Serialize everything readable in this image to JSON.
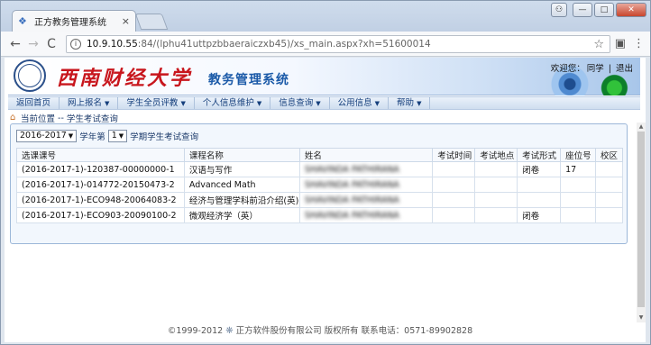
{
  "browser": {
    "tab_title": "正方教务管理系统",
    "tab_close": "×",
    "back": "←",
    "forward": "→",
    "reload": "C",
    "info_icon": "i",
    "url_host": "10.9.10.55",
    "url_path": ":84/(lphu41uttpzbbaeraiczxb45)/xs_main.aspx?xh=51600014",
    "star": "☆",
    "minimize": "—",
    "maximize": "□",
    "close": "✕",
    "user": "⚇",
    "menu": "⋮",
    "ext": "▣"
  },
  "banner": {
    "university": "西南财经大学",
    "system": "教务管理系统",
    "welcome": "欢迎您：",
    "user_name": "同学",
    "separator": "|",
    "logout": "退出"
  },
  "menu": [
    {
      "label": "返回首页",
      "caret": ""
    },
    {
      "label": "网上报名",
      "caret": "▼"
    },
    {
      "label": "学生全员评教",
      "caret": "▼"
    },
    {
      "label": "个人信息维护",
      "caret": "▼"
    },
    {
      "label": "信息查询",
      "caret": "▼"
    },
    {
      "label": "公用信息",
      "caret": "▼"
    },
    {
      "label": "帮助",
      "caret": "▼"
    }
  ],
  "breadcrumb": {
    "prefix": "当前位置",
    "separator": " -- ",
    "current": "学生考试查询"
  },
  "filter": {
    "year_value": "2016-2017",
    "year_label": "学年第",
    "term_value": "1",
    "term_label": "学期学生考试查询"
  },
  "table": {
    "headers": [
      "选课课号",
      "课程名称",
      "姓名",
      "考试时间",
      "考试地点",
      "考试形式",
      "座位号",
      "校区"
    ],
    "rows": [
      [
        "(2016-2017-1)-120387-00000000-1",
        "汉语与写作",
        "SHAVINDA PATHIRANA",
        "",
        "",
        "闭卷",
        "17",
        ""
      ],
      [
        "(2016-2017-1)-014772-20150473-2",
        "Advanced Math",
        "SHAVINDA PATHIRANA",
        "",
        "",
        "",
        "",
        ""
      ],
      [
        "(2016-2017-1)-ECO948-20064083-2",
        "经济与管理学科前沿介绍(英)",
        "SHAVINDA PATHIRANA",
        "",
        "",
        "",
        "",
        ""
      ],
      [
        "(2016-2017-1)-ECO903-20090100-2",
        "微观经济学（英）",
        "SHAVINDA PATHIRANA",
        "",
        "",
        "闭卷",
        "",
        ""
      ]
    ]
  },
  "footer": {
    "copyright": "©1999-2012",
    "company": "正方软件股份有限公司 版权所有 联系电话：0571-89902828"
  },
  "colors": {
    "brand_red": "#c8161d",
    "brand_blue": "#1b5aa8"
  }
}
